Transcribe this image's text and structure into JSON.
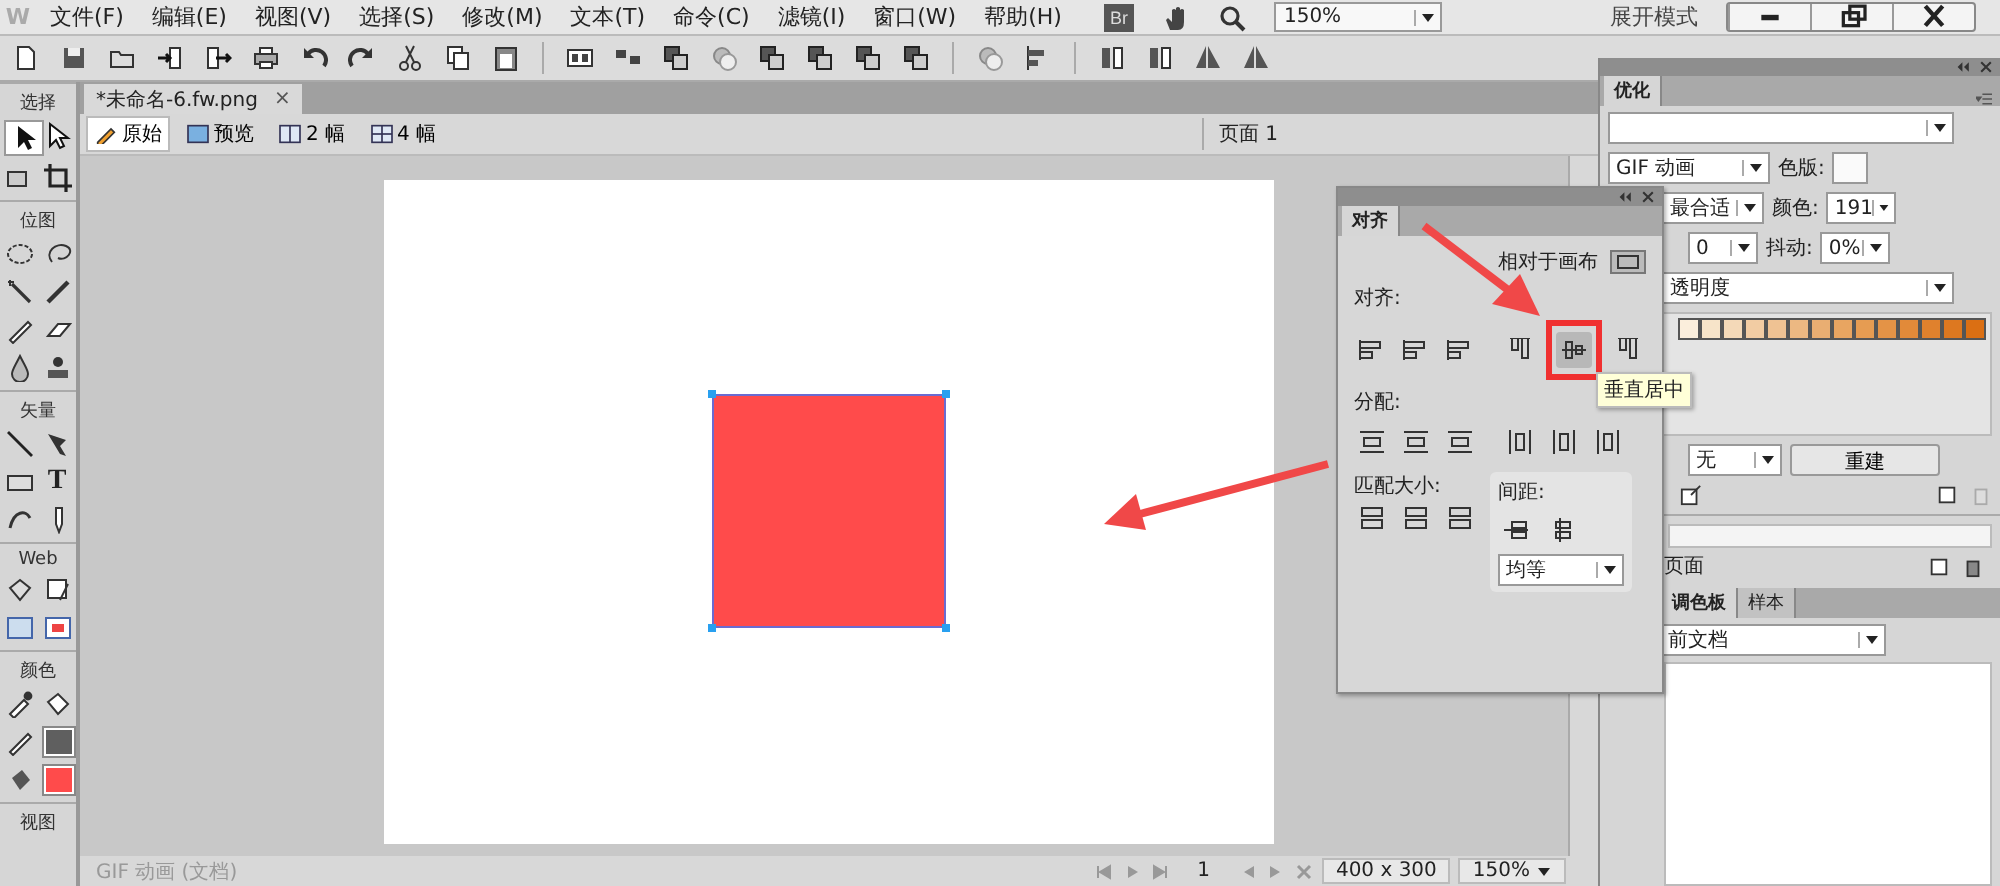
{
  "app_logo": "W",
  "menu": [
    "文件(F)",
    "编辑(E)",
    "视图(V)",
    "选择(S)",
    "修改(M)",
    "文本(T)",
    "命令(C)",
    "滤镜(I)",
    "窗口(W)",
    "帮助(H)"
  ],
  "bridge_button": "Br",
  "zoom_field": "150%",
  "workspace_mode": "展开模式",
  "document_tab": {
    "title": "*未命名-6.fw.png",
    "close": "×"
  },
  "view_modes": [
    {
      "label": "原始",
      "selected": true
    },
    {
      "label": "预览",
      "selected": false
    },
    {
      "label": "2 幅",
      "selected": false
    },
    {
      "label": "4 幅",
      "selected": false
    }
  ],
  "page_selector": "页面 1",
  "toolbox": {
    "sections": [
      "选择",
      "位图",
      "矢量",
      "Web",
      "颜色",
      "视图"
    ],
    "text_tool": "T",
    "color_wells": [
      {
        "color": "#5f5f5f"
      },
      {
        "color": "#ff4b4b"
      }
    ]
  },
  "status_bar": {
    "document_type": "GIF 动画 (文档)",
    "frame": "1",
    "image_size": "400 x 300",
    "zoom": "150%"
  },
  "align_panel": {
    "tab": "对齐",
    "relative_to": "相对于画布",
    "align_label": "对齐:",
    "distribute_label": "分配:",
    "match_size_label": "匹配大小:",
    "spacing_label": "间距:",
    "spacing_value": "均等",
    "tooltip": "垂直居中"
  },
  "optimize_panel": {
    "tab": "优化",
    "format": "GIF 动画",
    "palette_label": "色版:",
    "palette": "最合适",
    "colors_label": "颜色:",
    "colors": "191",
    "loss": "0",
    "dither_label": "抖动:",
    "dither": "0%",
    "transparency": "透明度",
    "swatches": [
      {
        "color": "#fbeedc"
      },
      {
        "color": "#f7e4c9"
      },
      {
        "color": "#f4d9b8"
      },
      {
        "color": "#f2cca3"
      },
      {
        "color": "#efc293"
      },
      {
        "color": "#ecb882"
      },
      {
        "color": "#e9ae72"
      },
      {
        "color": "#e8a561"
      },
      {
        "color": "#e69c52"
      },
      {
        "color": "#e49346"
      },
      {
        "color": "#e28a39"
      },
      {
        "color": "#e0812d"
      },
      {
        "color": "#dd7820"
      },
      {
        "color": "#db6f13"
      }
    ],
    "matte": "无",
    "rebuild_button": "重建"
  },
  "pages_panel": {
    "title": "页面"
  },
  "palette_panel": {
    "tabs": [
      {
        "label": "调色板",
        "selected": true
      },
      {
        "label": "样本",
        "selected": false
      }
    ],
    "source": "前文档"
  }
}
